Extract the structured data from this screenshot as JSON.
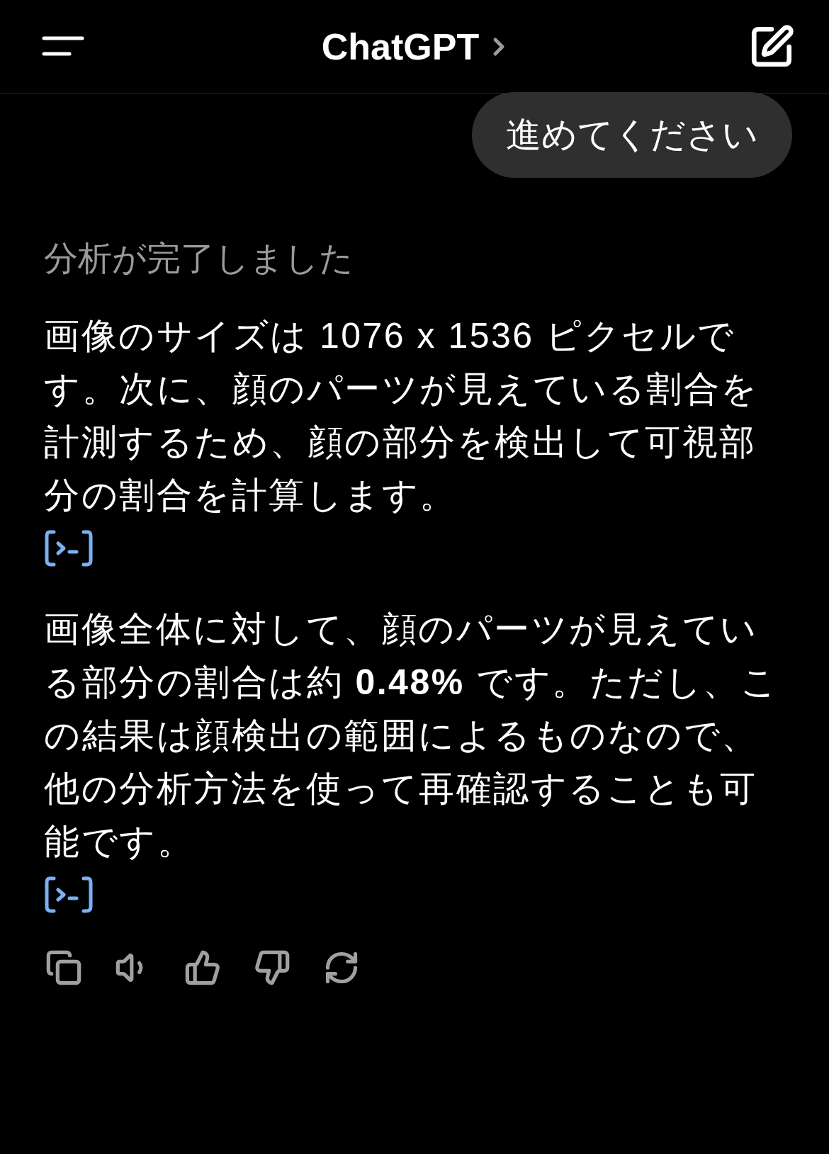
{
  "header": {
    "title": "ChatGPT"
  },
  "messages": [
    {
      "kind": "user",
      "text": "進めてください"
    },
    {
      "kind": "status",
      "text": "分析が完了しました"
    },
    {
      "kind": "assistant",
      "paragraphs": [
        {
          "text": "画像のサイズは 1076 x 1536 ピクセルです。次に、顔のパーツが見えている割合を計測するため、顔の部分を検出して可視部分の割合を計算します。",
          "code_link": true
        },
        {
          "text": "画像全体に対して、顔のパーツが見えている部分の割合は約 **0.48%** です。ただし、この結果は顔検出の範囲によるものなので、他の分析方法を使って再確認することも可能です。",
          "code_link": true
        }
      ]
    }
  ],
  "actions": [
    {
      "kind": "copy"
    },
    {
      "kind": "speak"
    },
    {
      "kind": "like"
    },
    {
      "kind": "dislike"
    },
    {
      "kind": "regenerate"
    }
  ]
}
